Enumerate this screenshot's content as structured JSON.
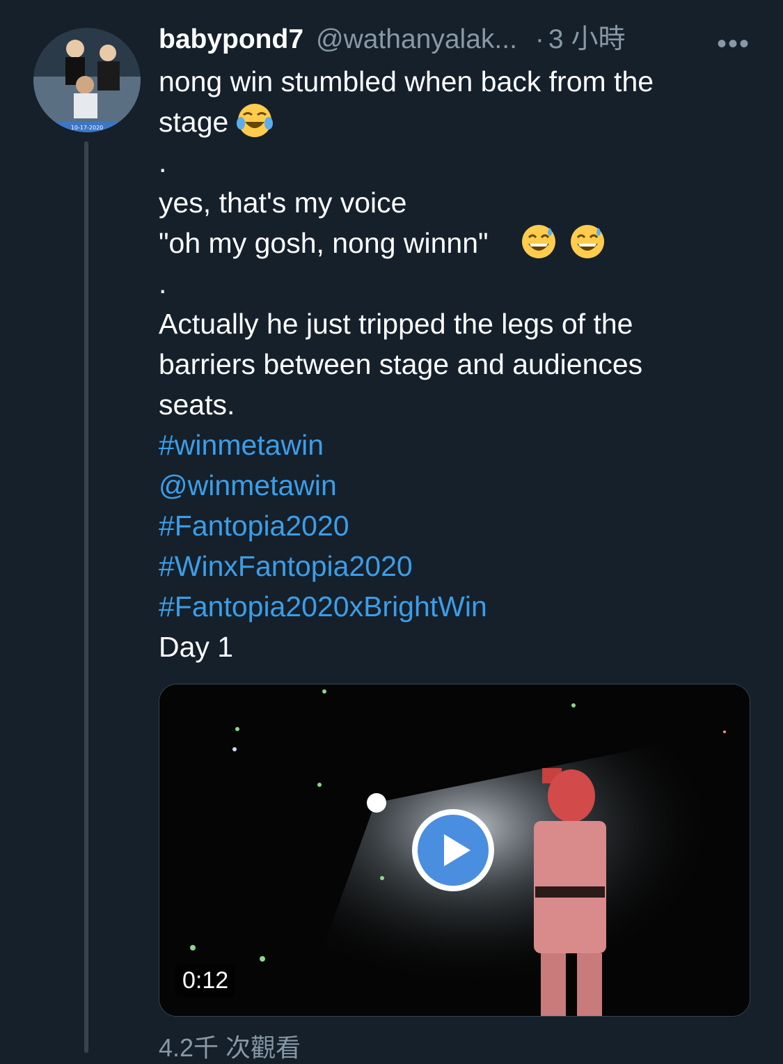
{
  "tweet": {
    "display_name": "babypond7",
    "handle": "@wathanyalak...",
    "separator": "·",
    "time": "3 小時",
    "more_label": "•••",
    "avatar_date": "10-17-2020",
    "body_lines": [
      {
        "text": "nong win stumbled when back from the",
        "type": "text"
      },
      {
        "text": "stage",
        "type": "text",
        "emoji": "face-with-tears-of-joy"
      },
      {
        "text": ".",
        "type": "text"
      },
      {
        "text": "yes, that's my voice",
        "type": "text"
      },
      {
        "text": "\"oh my gosh, nong winnn\"",
        "type": "text",
        "emoji2": "grinning-face-with-sweat"
      },
      {
        "text": ".",
        "type": "text"
      },
      {
        "text": "Actually he just tripped the legs of the",
        "type": "text"
      },
      {
        "text": "barriers between stage and audiences",
        "type": "text"
      },
      {
        "text": "seats.",
        "type": "text"
      },
      {
        "text": "#winmetawin",
        "type": "link"
      },
      {
        "text": "@winmetawin",
        "type": "link"
      },
      {
        "text": "#Fantopia2020",
        "type": "link"
      },
      {
        "text": "#WinxFantopia2020",
        "type": "link"
      },
      {
        "text": "#Fantopia2020xBrightWin",
        "type": "link"
      },
      {
        "text": "Day 1",
        "type": "text"
      }
    ],
    "video": {
      "duration": "0:12",
      "play_icon": "play-icon"
    },
    "views": "4.2千 次觀看"
  },
  "colors": {
    "background": "#15202b",
    "link": "#3c9ee8",
    "muted": "#8899a6",
    "play": "#4a8ee0"
  }
}
